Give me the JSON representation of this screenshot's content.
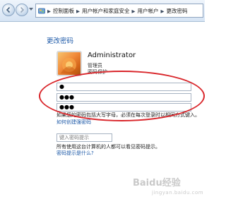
{
  "breadcrumb": {
    "items": [
      "控制面板",
      "用户帐户和家庭安全",
      "用户帐户",
      "更改密码"
    ]
  },
  "page": {
    "title": "更改密码"
  },
  "user": {
    "name": "Administrator",
    "role": "管理员",
    "status": "密码保护"
  },
  "password_fields": {
    "current_value": "●",
    "new_value": "●●●",
    "confirm_value": "●●●"
  },
  "help": {
    "case_note": "如果您的密码包括大写字母，必须在每次登录时以相同方式键入。",
    "strong_password_link": "如何创建强密码",
    "hint_placeholder": "键入密码提示",
    "hint_visibility_note": "所有使用这台计算机的人都可以看见密码提示。",
    "what_is_hint_link": "密码提示是什么?"
  },
  "watermark": {
    "brand": "Baidu经验",
    "domain": "jingyan.baidu.com"
  },
  "colors": {
    "link": "#1e5aa8",
    "annotation_oval": "#d9252a",
    "toolbar_top": "#eef4fb",
    "toolbar_bottom": "#d6e4f4"
  },
  "icons": {
    "back": "back-arrow-icon",
    "forward": "forward-arrow-icon",
    "control_panel": "control-panel-icon",
    "avatar": "flower-avatar-icon"
  }
}
